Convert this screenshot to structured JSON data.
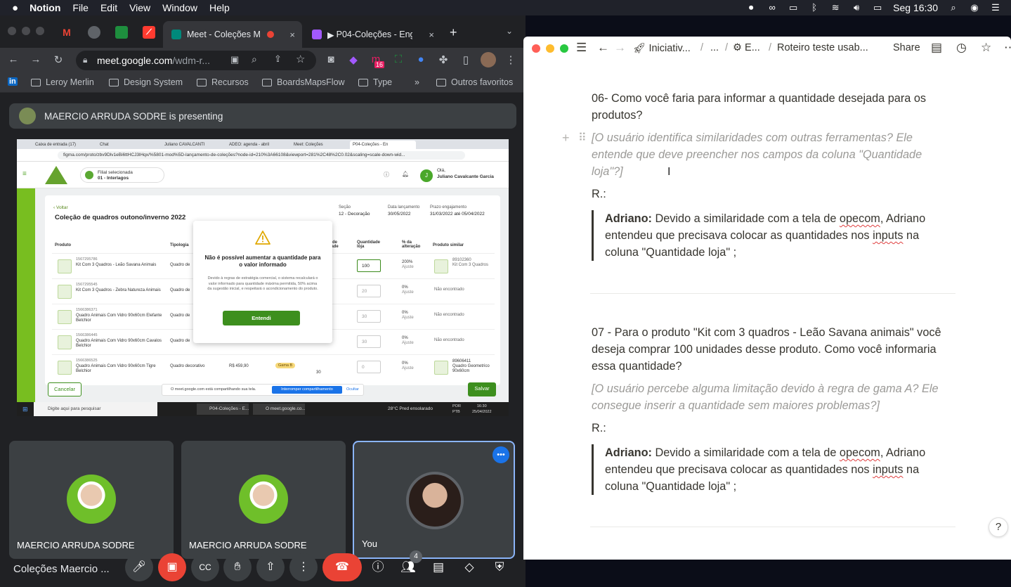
{
  "menubar": {
    "apple": "",
    "app": "Notion",
    "items": [
      "File",
      "Edit",
      "View",
      "Window",
      "Help"
    ],
    "clock": "Seg 16:30"
  },
  "chrome": {
    "tabs": [
      {
        "title": "Meet - Coleções M",
        "close": "×"
      },
      {
        "title": "P04-Coleções - Eng",
        "close": "×"
      }
    ],
    "new_tab": "+",
    "url_main": "meet.google.com",
    "url_rest": "/wdm-r...",
    "ext_badge": "16",
    "bookmarks": [
      "Leroy Merlin",
      "Design System",
      "Recursos",
      "BoardsMapsFlow",
      "Type"
    ],
    "bookmarks_more": "»",
    "other_bookmarks": "Outros favoritos"
  },
  "meet": {
    "presenting": "MAERCIO ARRUDA SODRE is presenting",
    "participants": [
      "MAERCIO ARRUDA SODRE",
      "MAERCIO ARRUDA SODRE",
      "You"
    ],
    "meeting_name": "Coleções Maercio ...",
    "people_count": "4"
  },
  "shared_screen": {
    "remote_tabs": [
      "Caixa de entrada (17)",
      "Chat",
      "Juliano CAVALCANTI",
      "ADEO: agenda - abril",
      "Meet: Coleções",
      "P04-Coleções - En"
    ],
    "url": "figma.com/proto/zbv9Dlv1eBi6ttHCJ3lHqx/%5801-mod%5D-lançamento-de-coleções?node-id=210%3A66108&viewport=281%2C48%2C0.02&scaling=scale-down-wid...",
    "store_label": "Filial selecionada",
    "store_value": "01 - Interlagos",
    "user_greeting": "Olá,",
    "user_name": "Juliano Cavalcante Garcia",
    "user_initial": "J",
    "back": "Voltar",
    "collection_title": "Coleção de quadros outono/inverno 2022",
    "meta": [
      {
        "label": "Seção",
        "value": "12 - Decoração"
      },
      {
        "label": "Data lançamento",
        "value": "30/05/2022"
      },
      {
        "label": "Prazo engajamento",
        "value": "31/03/2022 até 05/04/2022"
      }
    ],
    "columns": [
      "Produto",
      "Tipologia",
      "io de idade",
      "Quantidade loja",
      "% da alteração",
      "Produto similar"
    ],
    "rows": [
      {
        "code": "1567295786",
        "name": "Kit Com 3 Quadros - Leão Savana Animais",
        "tip": "Quadro de",
        "qty": "100",
        "pct": "200%",
        "pct_note": "Ajuste",
        "similar_code": "89102360",
        "similar": "Kit Com 3 Quadros"
      },
      {
        "code": "1567295545",
        "name": "Kit Com 3 Quadros - Zebra Natureza Animais",
        "tip": "Quadro de",
        "qty": "20",
        "pct": "0%",
        "pct_note": "Ajuste",
        "similar": "Não encontrado"
      },
      {
        "code": "1566386371",
        "name": "Quadro Animais Com Vidro 90x60cm Elefante Belchior",
        "tip": "Quadro de",
        "qty": "30",
        "pct": "0%",
        "pct_note": "Ajuste",
        "similar": "Não encontrado"
      },
      {
        "code": "1566386445",
        "name": "Quadro Animais Com Vidro 90x60cm Cavalos Belchior",
        "tip": "Quadro de",
        "qty": "30",
        "pct": "0%",
        "pct_note": "Ajuste",
        "similar": "Não encontrado"
      },
      {
        "code": "1566386525",
        "name": "Quadro Animais Com Vidro 90x60cm Tigre Belchior",
        "tip": "Quadro decorativo",
        "price": "R$ 459,90",
        "gama": "Gama B",
        "q": "30",
        "qty": "0",
        "pct": "0%",
        "pct_note": "Ajuste",
        "similar_code": "89606411",
        "similar": "Quadro Geometrico 90x60cm"
      }
    ],
    "modal": {
      "title": "Não é possível aumentar a quantidade para o valor informado",
      "body": "Devido à regras de estratégia comercial, o sistema recalculará o valor informado para quantidade máxima permitida, 50% acima da sugestão inicial, e respeitará o acondicionamento do produto.",
      "button": "Entendi"
    },
    "cancel": "Cancelar",
    "save": "Salvar",
    "sharing_notice": "O meet.google.com está compartilhando sua tela.",
    "stop_sharing": "Interromper compartilhamento",
    "hide": "Ocultar",
    "taskbar_search": "Digite aqui para pesquisar",
    "taskbar_tasks": [
      "P04-Coleções - E...",
      "O meet.google.co..."
    ],
    "weather": "28°C  Pred ensolarado",
    "lang": "POR",
    "lang2": "PTB",
    "time": "16:30",
    "date": "25/04/2022"
  },
  "notion": {
    "breadcrumbs": [
      "Iniciativ...",
      "...",
      "E...",
      "Roteiro teste usab..."
    ],
    "share": "Share",
    "q6": "06- Como você faria para informar a quantidade desejada para os produtos?",
    "q6_hint": "[O usuário identifica similaridades com outras ferramentas? Ele entende que deve preencher nos campos da coluna \"Quantidade loja\"?]",
    "r_label": "R.:",
    "answer_name": "Adriano:",
    "answer_pre": "Devido a similaridade com a tela de ",
    "answer_word1": "opecom",
    "answer_mid": ", Adriano entendeu que precisava colocar as quantidades nos ",
    "answer_word2": "inputs",
    "answer_post": " na coluna \"Quantidade loja\" ;",
    "q7": "07 - Para o produto \"Kit com 3 quadros - Leão Savana animais\" você deseja comprar 100 unidades desse produto. Como você informaria essa quantidade?",
    "q7_hint": "[O usuário percebe alguma limitação devido à regra de gama A? Ele consegue inserir a quantidade sem maiores problemas?]",
    "help": "?"
  }
}
